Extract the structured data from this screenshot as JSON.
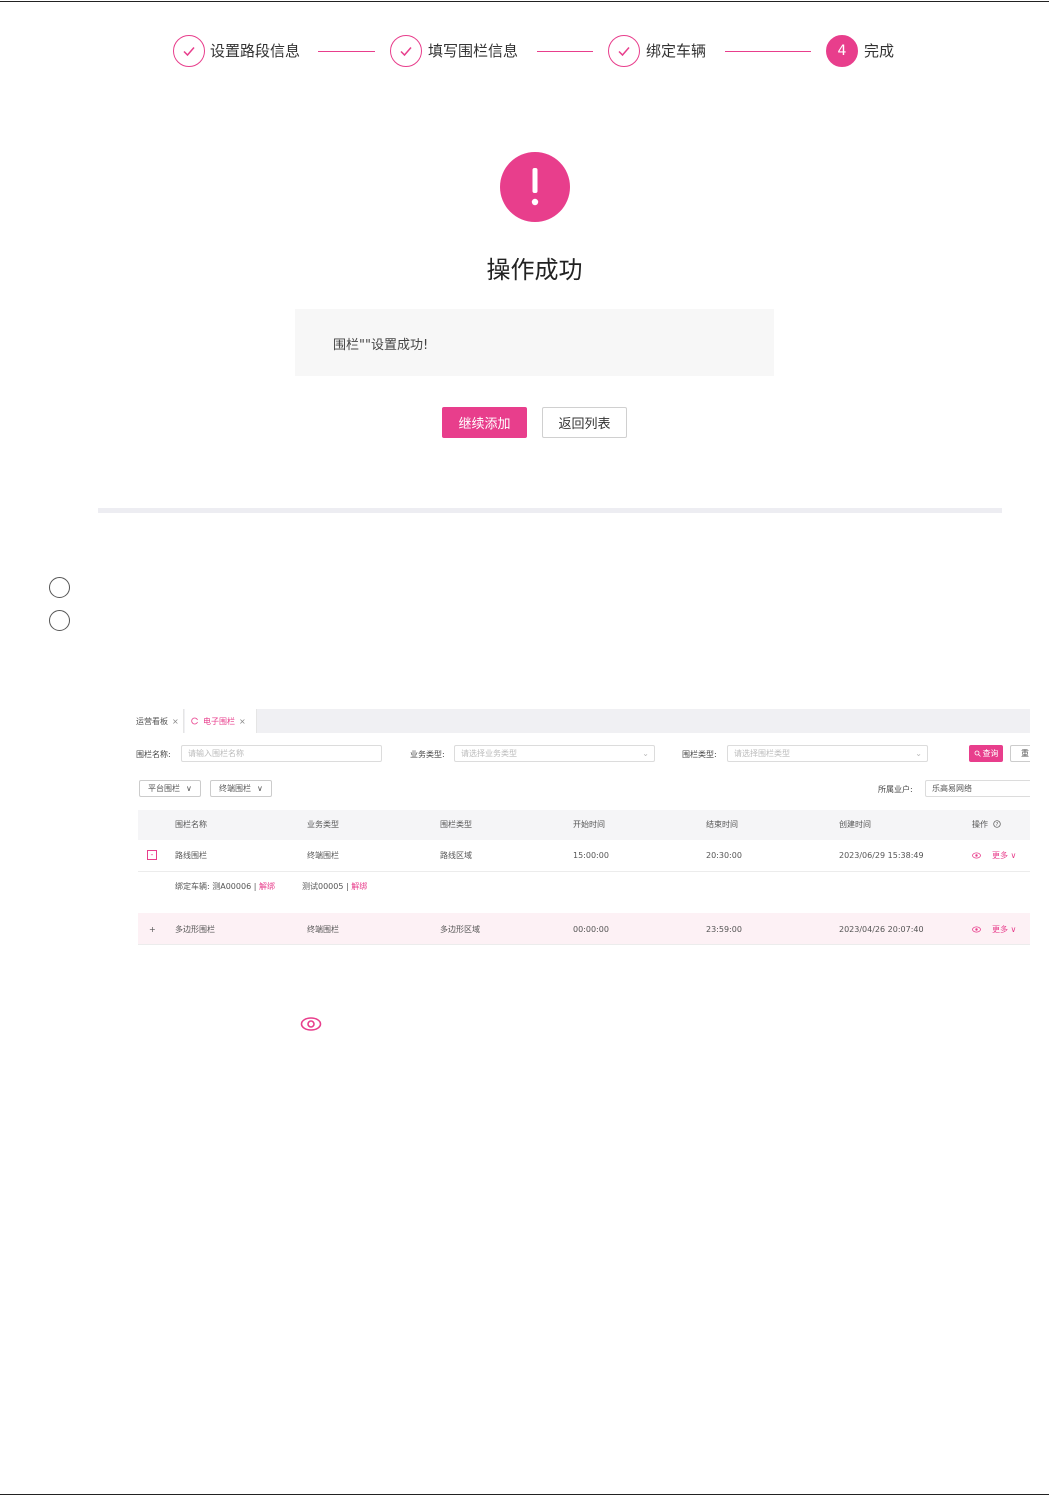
{
  "steps": [
    {
      "label": "设置路段信息",
      "status": "done"
    },
    {
      "label": "填写围栏信息",
      "status": "done"
    },
    {
      "label": "绑定车辆",
      "status": "done"
    },
    {
      "label": "完成",
      "number": "4",
      "status": "active"
    }
  ],
  "result": {
    "title": "操作成功",
    "message": "围栏\"\"设置成功!",
    "primary_button": "继续添加",
    "secondary_button": "返回列表"
  },
  "screenshot": {
    "tabs": [
      {
        "label": "运营看板",
        "close": "×"
      },
      {
        "label": "电子围栏",
        "close": "×"
      }
    ],
    "filters": {
      "fence_name_label": "围栏名称:",
      "fence_name_placeholder": "请输入围栏名称",
      "business_type_label": "业务类型:",
      "business_type_placeholder": "请选择业务类型",
      "fence_type_label": "围栏类型:",
      "fence_type_placeholder": "请选择围栏类型",
      "query_button": "查询",
      "reset_button": "重"
    },
    "dropdowns": {
      "platform": "平台围栏",
      "terminal": "终端围栏"
    },
    "tenant": {
      "label": "所属业户:",
      "value": "乐高易网络"
    },
    "columns": [
      "围栏名称",
      "业务类型",
      "围栏类型",
      "开始时间",
      "结束时间",
      "创建时间",
      "操作"
    ],
    "rows": [
      {
        "name": "路线围栏",
        "business_type": "终端围栏",
        "fence_type": "路线区域",
        "start": "15:00:00",
        "end": "20:30:00",
        "created": "2023/06/29 15:38:49",
        "more": "更多",
        "expander": "-"
      },
      {
        "name": "多边形围栏",
        "business_type": "终端围栏",
        "fence_type": "多边形区域",
        "start": "00:00:00",
        "end": "23:59:00",
        "created": "2023/04/26 20:07:40",
        "more": "更多",
        "expander": "+"
      }
    ],
    "binding": {
      "label": "绑定车辆:",
      "vehicle1": "测A00006",
      "vehicle2": "测试00005",
      "unbind": "解绑",
      "separator": "|"
    }
  }
}
